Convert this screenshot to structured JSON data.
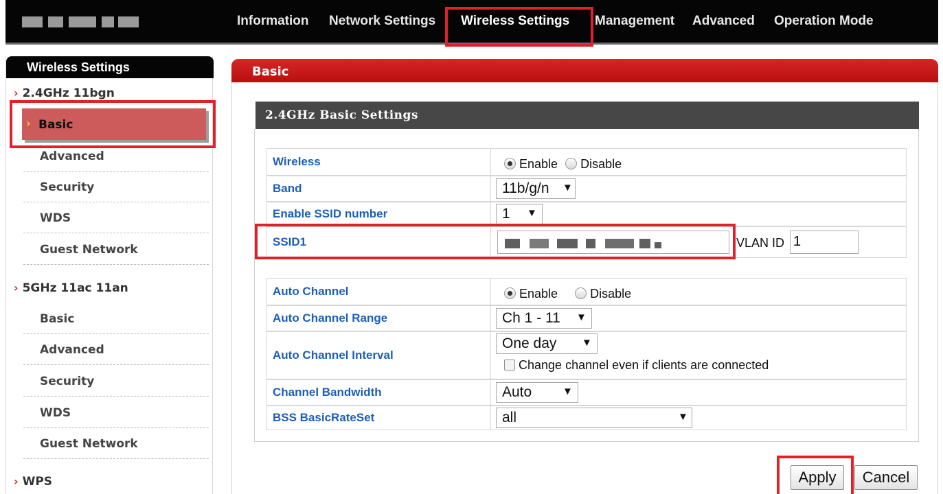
{
  "top_nav": {
    "items": [
      {
        "label": "Information"
      },
      {
        "label": "Network Settings"
      },
      {
        "label": "Wireless Settings",
        "active": true
      },
      {
        "label": "Management"
      },
      {
        "label": "Advanced"
      },
      {
        "label": "Operation Mode"
      }
    ]
  },
  "sidebar": {
    "header": "Wireless Settings",
    "groups": [
      {
        "label": "2.4GHz 11bgn",
        "items": [
          {
            "label": "Basic",
            "selected": true
          },
          {
            "label": "Advanced"
          },
          {
            "label": "Security"
          },
          {
            "label": "WDS"
          },
          {
            "label": "Guest Network"
          }
        ]
      },
      {
        "label": "5GHz 11ac 11an",
        "items": [
          {
            "label": "Basic"
          },
          {
            "label": "Advanced"
          },
          {
            "label": "Security"
          },
          {
            "label": "WDS"
          },
          {
            "label": "Guest Network"
          }
        ]
      },
      {
        "label": "WPS"
      }
    ]
  },
  "main": {
    "header": "Basic",
    "panel_title": "2.4GHz Basic Settings",
    "fields": {
      "wireless": {
        "label": "Wireless",
        "options": [
          "Enable",
          "Disable"
        ],
        "selected": "Enable"
      },
      "band": {
        "label": "Band",
        "value": "11b/g/n"
      },
      "ssid_number": {
        "label": "Enable SSID number",
        "value": "1"
      },
      "ssid1": {
        "label": "SSID1",
        "value_obscured": true,
        "vlan_label": "VLAN ID",
        "vlan_value": "1"
      },
      "auto_channel": {
        "label": "Auto Channel",
        "options": [
          "Enable",
          "Disable"
        ],
        "selected": "Enable"
      },
      "auto_channel_range": {
        "label": "Auto Channel Range",
        "value": "Ch 1 - 11"
      },
      "auto_channel_interval": {
        "label": "Auto Channel Interval",
        "value": "One day",
        "checkbox_label": "Change channel even if clients are connected",
        "checked": false
      },
      "channel_bandwidth": {
        "label": "Channel Bandwidth",
        "value": "Auto"
      },
      "bss_basic_rate_set": {
        "label": "BSS BasicRateSet",
        "value": "all"
      }
    },
    "buttons": {
      "apply": "Apply",
      "cancel": "Cancel"
    }
  },
  "colors": {
    "accent_red": "#c62828",
    "highlight": "#e0202b",
    "link_blue": "#1c5fb8"
  }
}
